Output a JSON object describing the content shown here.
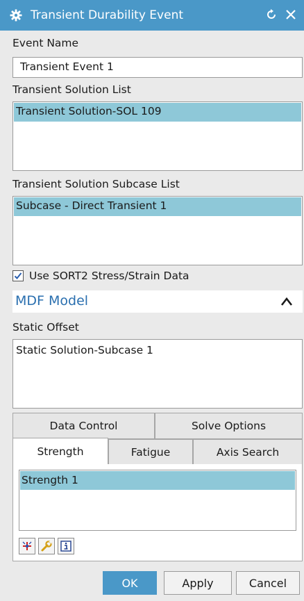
{
  "dialog": {
    "title": "Transient Durability Event"
  },
  "event_name": {
    "label": "Event Name",
    "value": "Transient Event 1"
  },
  "solution_list": {
    "label": "Transient Solution List",
    "items": [
      "Transient Solution-SOL 109"
    ]
  },
  "subcase_list": {
    "label": "Transient Solution Subcase List",
    "items": [
      "Subcase - Direct Transient 1"
    ]
  },
  "sort2_checkbox": {
    "label": "Use SORT2 Stress/Strain Data",
    "checked": true
  },
  "mdf_section": {
    "title": "MDF Model"
  },
  "static_offset": {
    "label": "Static Offset",
    "items": [
      "Static Solution-Subcase 1"
    ]
  },
  "tabs": {
    "row1": [
      "Data Control",
      "Solve Options"
    ],
    "row2": [
      "Strength",
      "Fatigue",
      "Axis Search"
    ],
    "active": "Strength"
  },
  "strength_list": {
    "items": [
      "Strength 1"
    ]
  },
  "toolbar_icons": [
    "new-icon",
    "wrench-icon",
    "info-icon"
  ],
  "buttons": {
    "ok": "OK",
    "apply": "Apply",
    "cancel": "Cancel"
  },
  "colors": {
    "accent": "#4a98c8",
    "selection": "#8ec8d8",
    "section_title": "#2a6faf"
  }
}
